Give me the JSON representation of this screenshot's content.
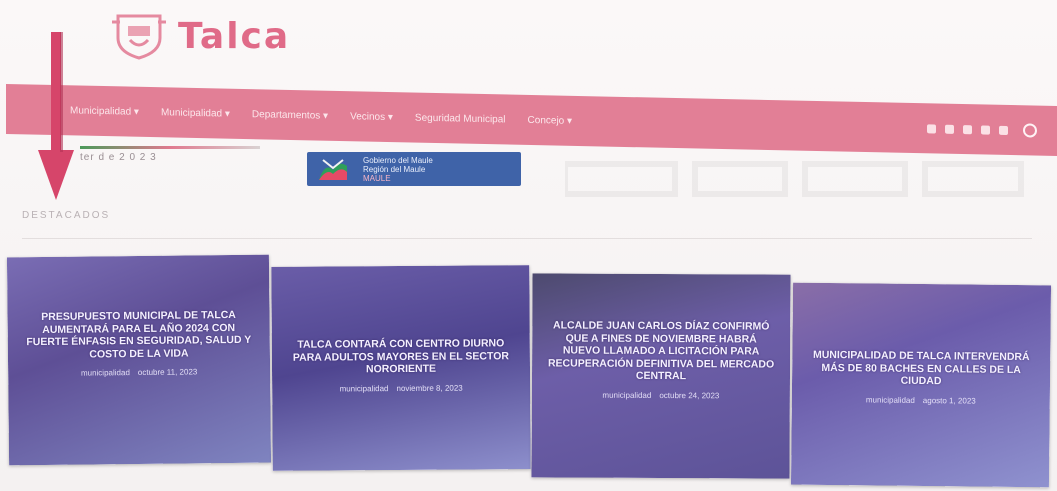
{
  "site": {
    "name": "Talca"
  },
  "nav": {
    "items": [
      {
        "label": "Municipalidad ▾"
      },
      {
        "label": "Municipalidad ▾"
      },
      {
        "label": "Departamentos ▾"
      },
      {
        "label": "Vecinos ▾"
      },
      {
        "label": "Seguridad Municipal"
      },
      {
        "label": "Concejo ▾"
      }
    ],
    "icons": [
      "facebook-icon",
      "twitter-icon",
      "instagram-icon",
      "youtube-icon",
      "mail-icon"
    ]
  },
  "info": {
    "date_text": "ter   d e  2 0 2 3",
    "banner_lines": [
      "Gobierno del Maule",
      "Región del Maule"
    ],
    "banner_sub": "MAULE"
  },
  "section": {
    "label": "DESTACADOS"
  },
  "cards": [
    {
      "title": "PRESUPUESTO MUNICIPAL DE TALCA AUMENTARÁ PARA EL AÑO 2024 CON FUERTE ÉNFASIS EN SEGURIDAD, SALUD Y COSTO DE LA VIDA",
      "author": "municipalidad",
      "date": "octubre 11, 2023"
    },
    {
      "title": "TALCA CONTARÁ CON CENTRO DIURNO PARA ADULTOS MAYORES EN EL SECTOR NORORIENTE",
      "author": "municipalidad",
      "date": "noviembre 8, 2023"
    },
    {
      "title": "ALCALDE JUAN CARLOS DÍAZ CONFIRMÓ QUE A FINES DE NOVIEMBRE HABRÁ NUEVO LLAMADO A LICITACIÓN PARA RECUPERACIÓN DEFINITIVA DEL MERCADO CENTRAL",
      "author": "municipalidad",
      "date": "octubre 24, 2023"
    },
    {
      "title": "MUNICIPALIDAD DE TALCA INTERVENDRÁ MÁS DE 80 BACHES EN CALLES DE LA CIUDAD",
      "author": "municipalidad",
      "date": "agosto 1, 2023"
    }
  ],
  "colors": {
    "brand": "#e06b88",
    "nav": "#e27f96",
    "card_overlay": "#6b5aa6",
    "arrow": "#d6456a"
  }
}
